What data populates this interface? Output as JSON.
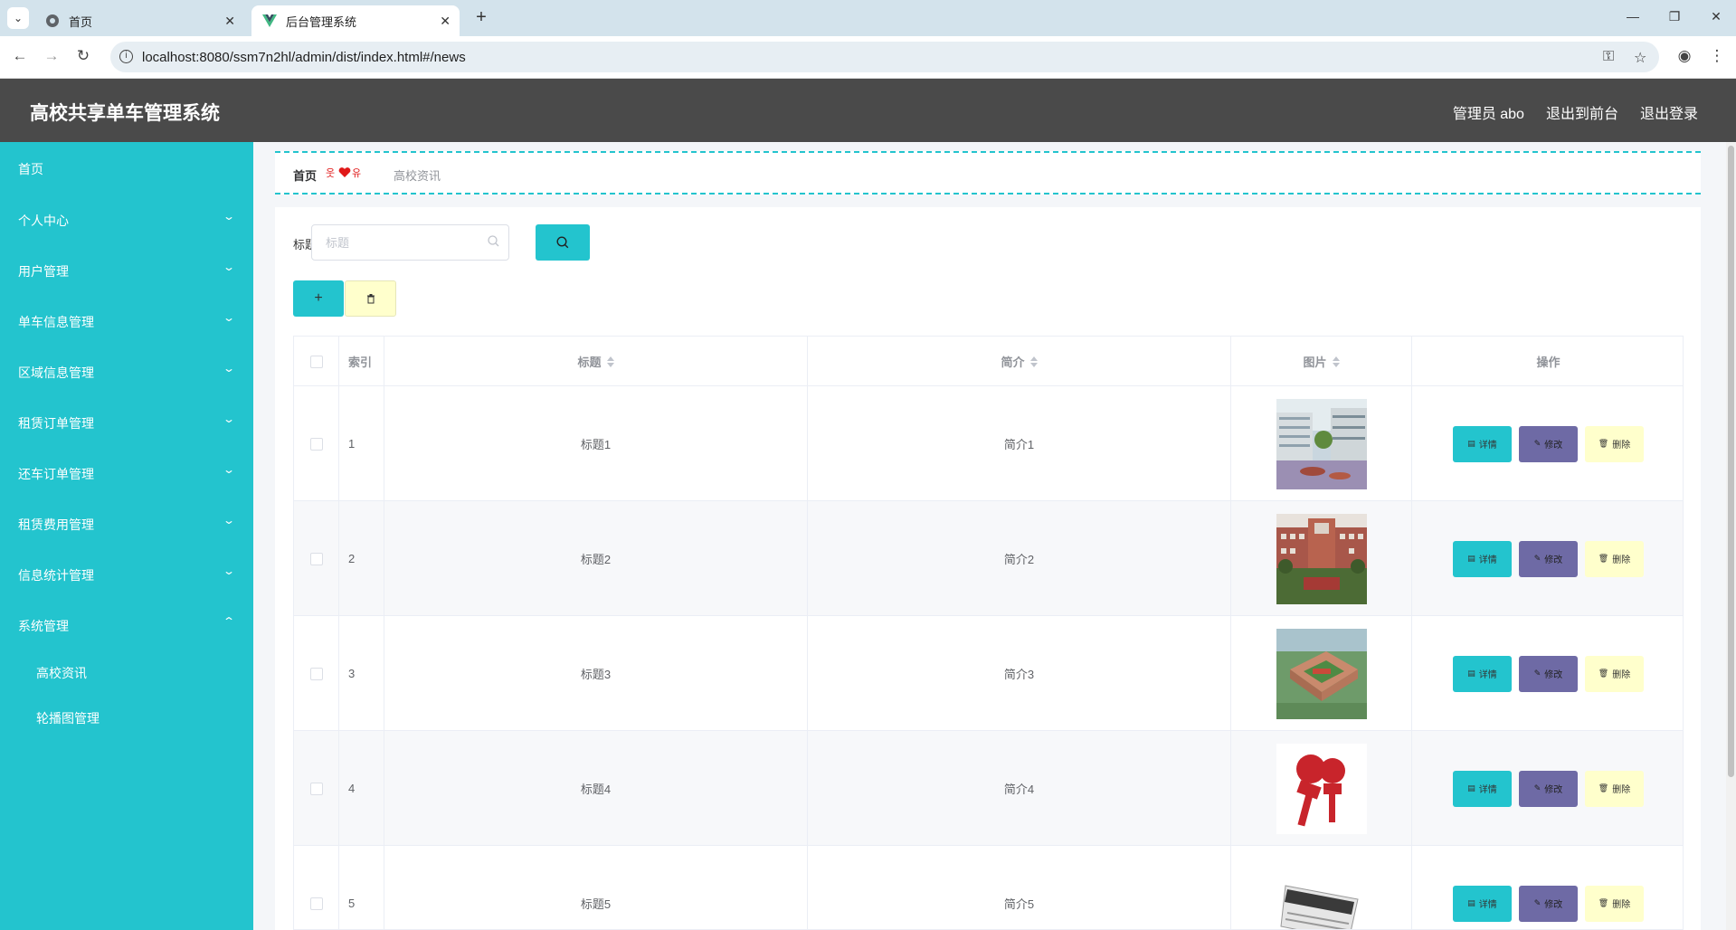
{
  "browser": {
    "tabs": [
      {
        "title": "首页",
        "active": false
      },
      {
        "title": "后台管理系统",
        "active": true
      }
    ],
    "url": "localhost:8080/ssm7n2hl/admin/dist/index.html#/news"
  },
  "header": {
    "app_title": "高校共享单车管理系统",
    "admin_label": "管理员 abo",
    "to_front": "退出到前台",
    "logout": "退出登录"
  },
  "sidebar": {
    "items": [
      {
        "label": "首页",
        "has_chevron": false
      },
      {
        "label": "个人中心",
        "has_chevron": true
      },
      {
        "label": "用户管理",
        "has_chevron": true
      },
      {
        "label": "单车信息管理",
        "has_chevron": true
      },
      {
        "label": "区域信息管理",
        "has_chevron": true
      },
      {
        "label": "租赁订单管理",
        "has_chevron": true
      },
      {
        "label": "还车订单管理",
        "has_chevron": true
      },
      {
        "label": "租赁费用管理",
        "has_chevron": true
      },
      {
        "label": "信息统计管理",
        "has_chevron": true
      },
      {
        "label": "系统管理",
        "has_chevron": true,
        "expanded": true
      }
    ],
    "sub_items": [
      "高校资讯",
      "轮播图管理"
    ]
  },
  "breadcrumb": {
    "home": "首页",
    "separator": "❤",
    "current": "高校资讯"
  },
  "search": {
    "label": "标题",
    "placeholder": "标题"
  },
  "table": {
    "headers": {
      "index": "索引",
      "title": "标题",
      "intro": "简介",
      "picture": "图片",
      "actions": "操作"
    },
    "rows": [
      {
        "index": "1",
        "title": "标题1",
        "intro": "简介1",
        "picture": "campus-courtyard"
      },
      {
        "index": "2",
        "title": "标题2",
        "intro": "简介2",
        "picture": "campus-building"
      },
      {
        "index": "3",
        "title": "标题3",
        "intro": "简介3",
        "picture": "campus-aerial"
      },
      {
        "index": "4",
        "title": "标题4",
        "intro": "简介4",
        "picture": "news-microphones"
      },
      {
        "index": "5",
        "title": "标题5",
        "intro": "简介5",
        "picture": "news-paper"
      }
    ],
    "actions": {
      "detail": "详情",
      "edit": "修改",
      "delete": "删除"
    }
  },
  "colors": {
    "accent": "#23c4ce",
    "header_bg": "#4a4a4a",
    "edit_btn": "#6e6aa5",
    "delete_btn": "#ffffcc"
  }
}
